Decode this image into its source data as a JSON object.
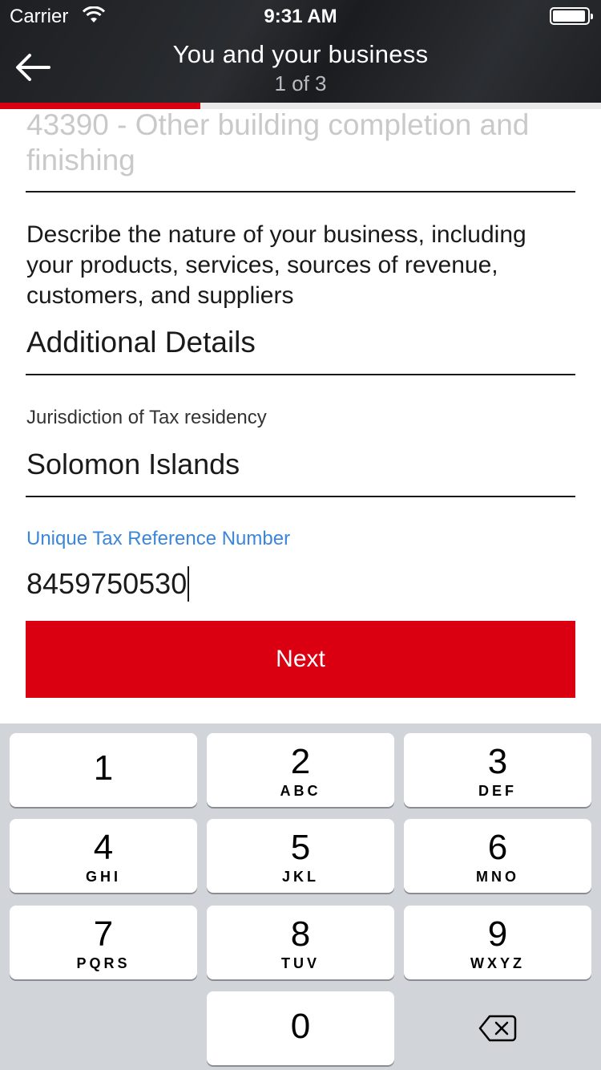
{
  "status_bar": {
    "carrier": "Carrier",
    "time": "9:31 AM"
  },
  "header": {
    "title": "You and your business",
    "step": "1 of 3",
    "progress_fraction": 0.333
  },
  "form": {
    "business_code_value": "43390 - Other building completion and finishing",
    "describe_prompt": "Describe the nature of your business, including your products, services, sources of revenue, customers, and suppliers",
    "additional_details": "Additional Details",
    "tax_residency_label": "Jurisdiction of Tax residency",
    "tax_residency_value": "Solomon Islands",
    "tax_ref_label": "Unique Tax Reference Number",
    "tax_ref_value": "8459750530",
    "next_label": "Next"
  },
  "keypad": {
    "keys": [
      {
        "digit": "1",
        "letters": ""
      },
      {
        "digit": "2",
        "letters": "ABC"
      },
      {
        "digit": "3",
        "letters": "DEF"
      },
      {
        "digit": "4",
        "letters": "GHI"
      },
      {
        "digit": "5",
        "letters": "JKL"
      },
      {
        "digit": "6",
        "letters": "MNO"
      },
      {
        "digit": "7",
        "letters": "PQRS"
      },
      {
        "digit": "8",
        "letters": "TUV"
      },
      {
        "digit": "9",
        "letters": "WXYZ"
      },
      {
        "digit": "0",
        "letters": ""
      }
    ]
  },
  "colors": {
    "brand_red": "#db0011",
    "focus_blue": "#3b86d8",
    "header_dark": "#1d1f22",
    "keypad_bg": "#d1d4d9"
  },
  "icons": {
    "back": "arrow-left-icon",
    "wifi": "wifi-icon",
    "battery": "battery-icon",
    "delete": "backspace-icon"
  }
}
